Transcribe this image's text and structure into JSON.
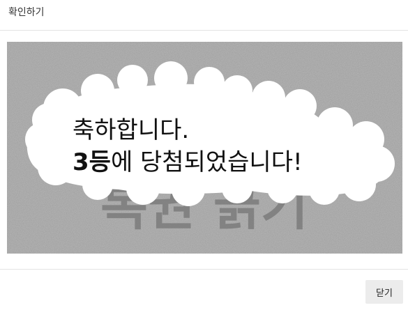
{
  "dialog": {
    "title": "확인하기",
    "close_label": "닫기"
  },
  "scratch_card": {
    "cover_text": "복권 긁기",
    "result_line1": "축하합니다.",
    "result_rank": "3등",
    "result_line2_rest": "에 당첨되었습니다!"
  },
  "colors": {
    "cover_gray": "#b4b4b4",
    "cover_text": "#7a7a7a",
    "revealed_area": "#ffffff",
    "button_bg": "#ececec"
  }
}
